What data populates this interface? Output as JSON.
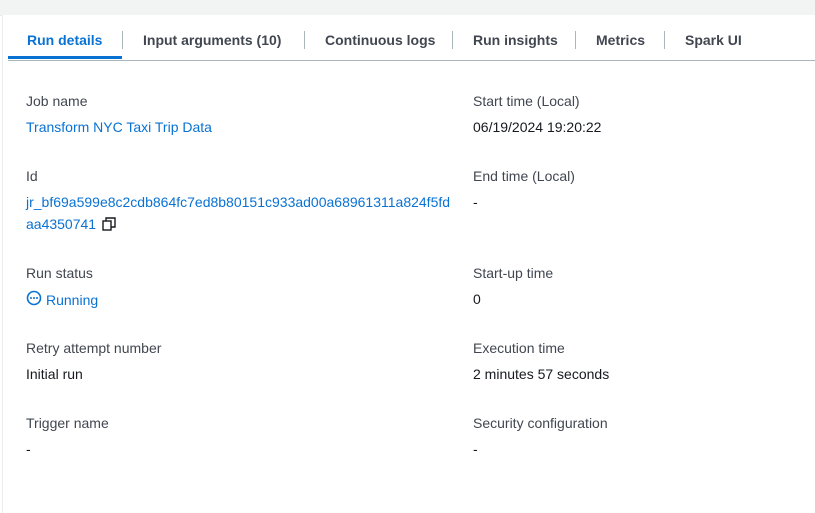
{
  "tabs": [
    {
      "label": "Run details"
    },
    {
      "label": "Input arguments (10)"
    },
    {
      "label": "Continuous logs"
    },
    {
      "label": "Run insights"
    },
    {
      "label": "Metrics"
    },
    {
      "label": "Spark UI"
    }
  ],
  "details": {
    "job_name": {
      "label": "Job name",
      "value": "Transform NYC Taxi Trip Data"
    },
    "start_time": {
      "label": "Start time (Local)",
      "value": "06/19/2024 19:20:22"
    },
    "id": {
      "label": "Id",
      "value_line1": "jr_bf69a599e8c2cdb864fc7ed8b80151c933ad00a68961311a824f5fd",
      "value_line2": "aa4350741"
    },
    "end_time": {
      "label": "End time (Local)",
      "value": "-"
    },
    "run_status": {
      "label": "Run status",
      "value": "Running"
    },
    "startup_time": {
      "label": "Start-up time",
      "value": "0"
    },
    "retry_attempt": {
      "label": "Retry attempt number",
      "value": "Initial run"
    },
    "execution_time": {
      "label": "Execution time",
      "value": "2 minutes 57 seconds"
    },
    "trigger_name": {
      "label": "Trigger name",
      "value": "-"
    },
    "security_config": {
      "label": "Security configuration",
      "value": "-"
    }
  },
  "icons": {
    "status": "running-status-icon",
    "copy": "copy-icon"
  },
  "colors": {
    "link": "#0972d3",
    "text": "#16191f",
    "label": "#414750"
  }
}
